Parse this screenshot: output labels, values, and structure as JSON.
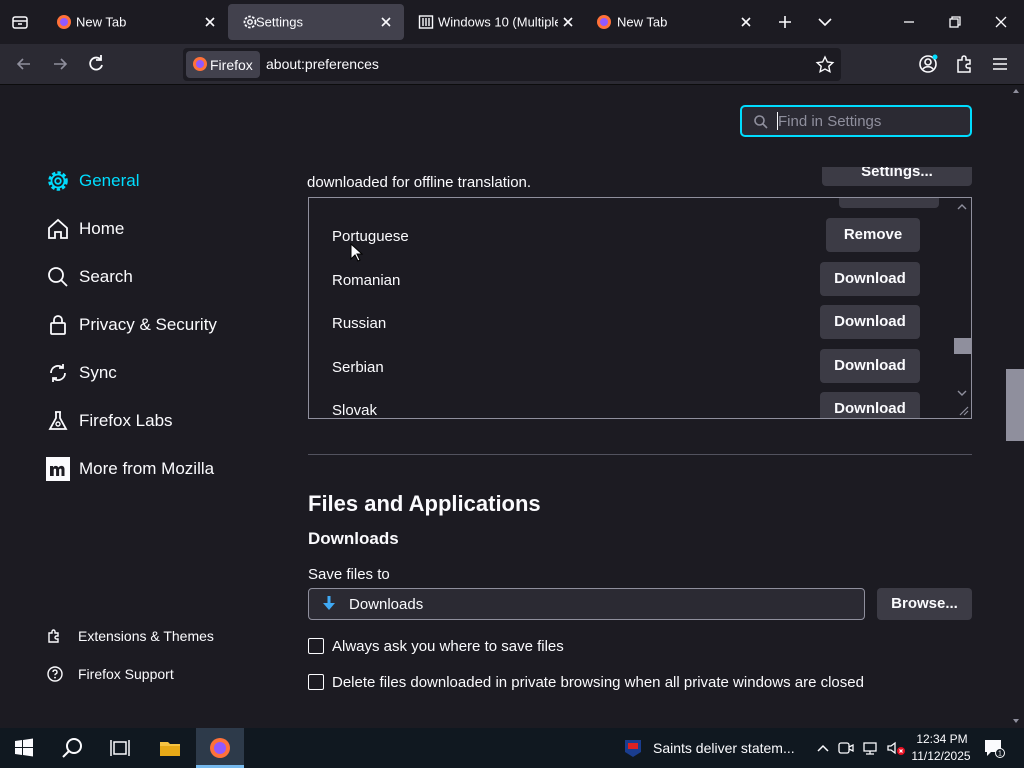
{
  "tabs": [
    {
      "title": "New Tab",
      "icon": "firefox-icon"
    },
    {
      "title": "Settings",
      "icon": "gear-icon",
      "active": true
    },
    {
      "title": "Windows 10 (Multiple E",
      "icon": "library-icon"
    },
    {
      "title": "New Tab",
      "icon": "firefox-icon"
    }
  ],
  "urlbar": {
    "identity": "Firefox",
    "url": "about:preferences"
  },
  "search": {
    "placeholder": "Find in Settings"
  },
  "sidebar": {
    "items": [
      {
        "label": "General",
        "icon": "gear-icon"
      },
      {
        "label": "Home",
        "icon": "home-icon"
      },
      {
        "label": "Search",
        "icon": "search-icon"
      },
      {
        "label": "Privacy & Security",
        "icon": "lock-icon"
      },
      {
        "label": "Sync",
        "icon": "sync-icon"
      },
      {
        "label": "Firefox Labs",
        "icon": "flask-icon"
      },
      {
        "label": "More from Mozilla",
        "icon": "mozilla-icon"
      }
    ],
    "footer": [
      {
        "label": "Extensions & Themes",
        "icon": "puzzle-icon"
      },
      {
        "label": "Firefox Support",
        "icon": "help-icon"
      }
    ]
  },
  "translation": {
    "description_tail": "downloaded for offline translation.",
    "settings_button": "Settings...",
    "languages": [
      {
        "name": "Portuguese",
        "action": "Remove"
      },
      {
        "name": "Romanian",
        "action": "Download"
      },
      {
        "name": "Russian",
        "action": "Download"
      },
      {
        "name": "Serbian",
        "action": "Download"
      },
      {
        "name": "Slovak",
        "action": "Download"
      }
    ]
  },
  "files": {
    "heading": "Files and Applications",
    "downloads_heading": "Downloads",
    "save_files_to": "Save files to",
    "folder": "Downloads",
    "browse": "Browse...",
    "always_ask": "Always ask you where to save files",
    "delete_private": "Delete files downloaded in private browsing when all private windows are closed"
  },
  "taskbar": {
    "news": "Saints deliver statem...",
    "time": "12:34 PM",
    "date": "11/12/2025"
  },
  "colors": {
    "accent": "#00ddff",
    "background": "#1c1b22",
    "button": "#3c3b45"
  }
}
